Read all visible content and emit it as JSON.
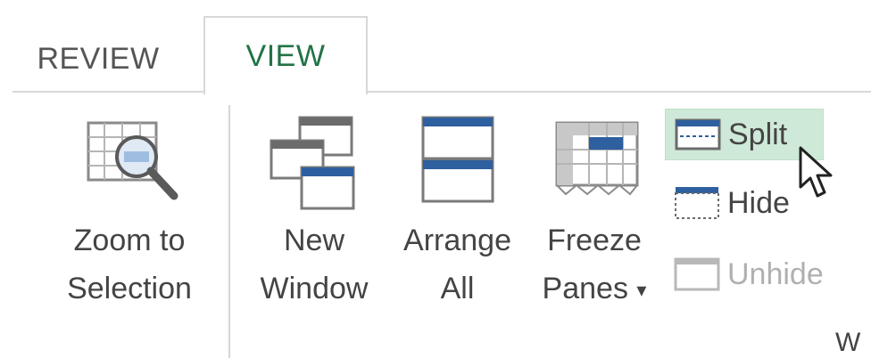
{
  "tabs": {
    "review": "REVIEW",
    "view": "VIEW"
  },
  "ribbon": {
    "zoom_to_selection": {
      "line1": "Zoom to",
      "line2": "Selection",
      "icon": "zoom-to-selection-icon"
    },
    "new_window": {
      "line1": "New",
      "line2": "Window",
      "icon": "new-window-icon"
    },
    "arrange_all": {
      "line1": "Arrange",
      "line2": "All",
      "icon": "arrange-all-icon"
    },
    "freeze_panes": {
      "line1": "Freeze",
      "line2": "Panes",
      "dropdown": "▾",
      "icon": "freeze-panes-icon"
    },
    "split": {
      "label": "Split",
      "icon": "split-icon",
      "state": "hovered"
    },
    "hide": {
      "label": "Hide",
      "icon": "hide-icon"
    },
    "unhide": {
      "label": "Unhide",
      "icon": "unhide-icon",
      "state": "disabled"
    },
    "group_label_partial": "W"
  },
  "colors": {
    "accent_green": "#217346",
    "hover_bg": "#cfe9d8",
    "icon_blue": "#2e5f9e",
    "disabled_text": "#b0b0b0"
  }
}
